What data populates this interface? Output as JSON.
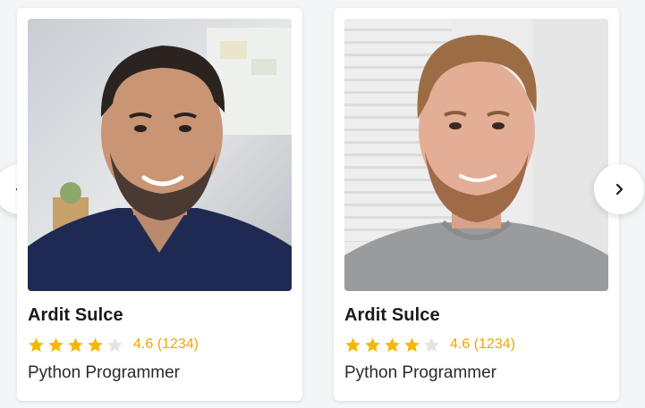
{
  "cards": [
    {
      "name": "Ardit Sulce",
      "rating_text": "4.6 (1234)",
      "stars": 4.6,
      "role": "Python Programmer",
      "photo": "instructor-photo"
    },
    {
      "name": "Ardit Sulce",
      "rating_text": "4.6 (1234)",
      "stars": 4.6,
      "role": "Python Programmer",
      "photo": "instructor-photo"
    }
  ],
  "colors": {
    "star_filled": "#f5b800",
    "star_empty": "#e3e3e3",
    "rating_text": "#f0a500"
  },
  "icons": {
    "prev": "chevron-left-icon",
    "next": "chevron-right-icon"
  }
}
